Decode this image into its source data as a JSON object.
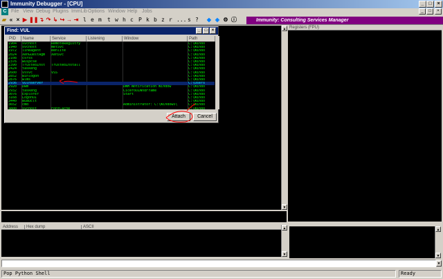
{
  "window": {
    "title": "Immunity Debugger - [CPU]"
  },
  "menu": [
    "File",
    "View",
    "Debug",
    "Plugins",
    "ImmLib",
    "Options",
    "Window",
    "Help",
    "Jobs"
  ],
  "toolbar": {
    "letters": [
      "l",
      "e",
      "m",
      "t",
      "w",
      "h",
      "c",
      "P",
      "k",
      "b",
      "z",
      "r",
      "...",
      "s",
      "?"
    ]
  },
  "banner": {
    "text": "Immunity: Consulting Services Manager"
  },
  "registers_header": "Registers (FPU)",
  "dump": {
    "cols": [
      "Address",
      "Hex dump",
      "ASCII"
    ]
  },
  "find_dialog": {
    "title": "Find: VUL",
    "cols": [
      "PID",
      "Name",
      "Service",
      "Listening",
      "Window",
      "Path"
    ],
    "rows": [
      {
        "pid": "1904",
        "name": "svchost",
        "service": "RemoteRegistry",
        "listening": "",
        "window": "",
        "path": "C:\\Windo"
      },
      {
        "pid": "1940",
        "name": "svchost",
        "service": "NetSvc",
        "listening": "",
        "window": "",
        "path": "C:\\Windo"
      },
      {
        "pid": "1972",
        "name": "lineagent",
        "service": "eenlite",
        "listening": "",
        "window": "",
        "path": "C:\\Windo"
      },
      {
        "pid": "2024",
        "name": "XenGuestAgm",
        "service": "XenSvc",
        "listening": "",
        "window": "",
        "path": "C:\\Windo"
      },
      {
        "pid": "2108",
        "name": "csrss",
        "service": "",
        "listening": "",
        "window": "",
        "path": "C:\\Windo"
      },
      {
        "pid": "2376",
        "name": "wuipcse",
        "service": "",
        "listening": "",
        "window": "",
        "path": "C:\\Windo"
      },
      {
        "pid": "2390",
        "name": "TrustedInst",
        "service": "TrustedInstall",
        "listening": "",
        "window": "",
        "path": "C:\\Windo"
      },
      {
        "pid": "2424",
        "name": "taskeng",
        "service": "",
        "listening": "",
        "window": "",
        "path": "C:\\Windo"
      },
      {
        "pid": "2600",
        "name": "vssvc",
        "service": "VSS",
        "listening": "",
        "window": "",
        "path": "C:\\Windo"
      },
      {
        "pid": "2852",
        "name": "winlogon",
        "service": "",
        "listening": "",
        "window": "",
        "path": "C:\\Windo"
      },
      {
        "pid": "2876",
        "name": "wlms",
        "service": "",
        "listening": "",
        "window": "",
        "path": "C:\\Windo"
      },
      {
        "pid": "2936",
        "name": "vulnserver",
        "service": "",
        "listening": "",
        "window": "",
        "path": "C:\\Users"
      },
      {
        "pid": "2920",
        "name": "Dwm",
        "service": "",
        "listening": "",
        "window": "DWM Notification Window",
        "path": "C:\\Windo"
      },
      {
        "pid": "2932",
        "name": "taskeng",
        "service": "",
        "listening": "",
        "window": "CiceroUIWndFrame",
        "path": "C:\\Windo"
      },
      {
        "pid": "3076",
        "name": "Explorer",
        "service": "",
        "listening": "",
        "window": "Start",
        "path": "C:\\Windo"
      },
      {
        "pid": "3168",
        "name": "LogonUI",
        "service": "",
        "listening": "",
        "window": "",
        "path": "C:\\Windo"
      },
      {
        "pid": "3440",
        "name": "wuauclt",
        "service": "",
        "listening": "",
        "window": "",
        "path": "C:\\Windo"
      },
      {
        "pid": "3652",
        "name": "cmd",
        "service": "",
        "listening": "",
        "window": "Administrator: C:\\Windows\\",
        "path": "C:\\Windo"
      },
      {
        "pid": "3800",
        "name": "svchost",
        "service": "FontCache",
        "listening": "",
        "window": "",
        "path": "C:\\Windo"
      },
      {
        "pid": "3912",
        "name": "msdtc",
        "service": "MSDTC",
        "listening": "",
        "window": "",
        "path": "C:\\Windo"
      }
    ],
    "selected_index": 11,
    "attach_label": "Attach",
    "cancel_label": "Cancel"
  },
  "status": {
    "left": "Pop Python Shell",
    "right": "Ready"
  },
  "colors": {
    "accent": "#800080",
    "selection": "#0a246a",
    "text": "#00ff00",
    "annotation": "#ff0000"
  }
}
